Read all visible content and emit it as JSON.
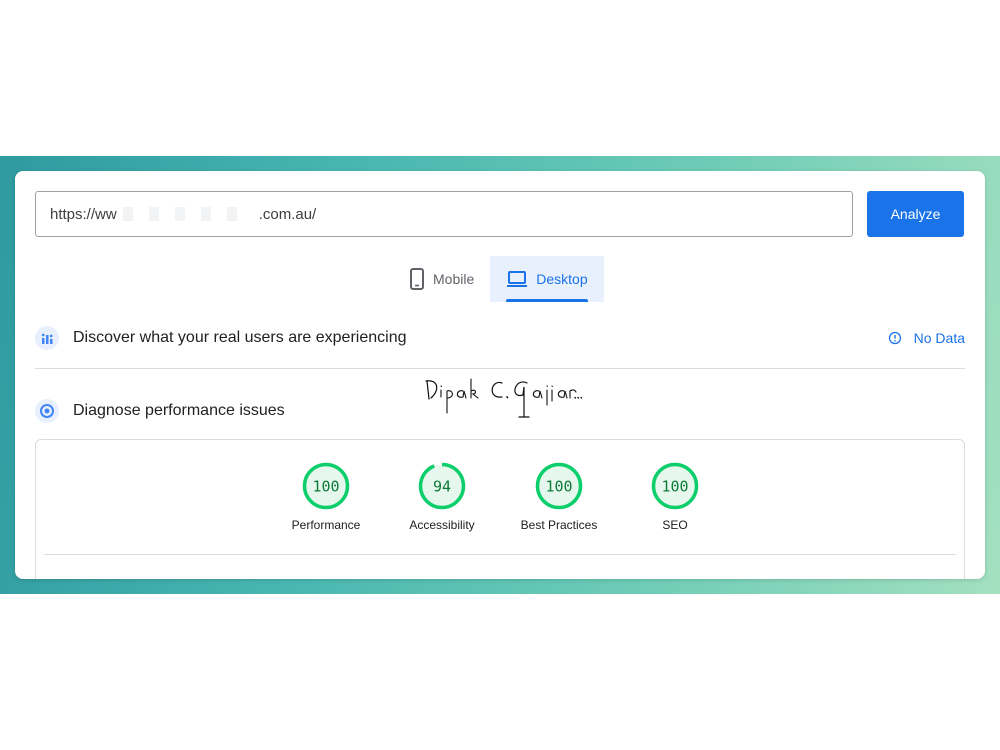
{
  "url_input": {
    "value_prefix": "https://ww",
    "value_suffix": ".com.au/"
  },
  "analyze_label": "Analyze",
  "tabs": [
    {
      "label": "Mobile",
      "icon": "phone-icon",
      "active": false
    },
    {
      "label": "Desktop",
      "icon": "laptop-icon",
      "active": true
    }
  ],
  "field_data": {
    "title": "Discover what your real users are experiencing",
    "status": "No Data",
    "icon": "users-chart-icon"
  },
  "lab_data": {
    "title": "Diagnose performance issues",
    "icon": "target-icon"
  },
  "scores": [
    {
      "label": "Performance",
      "value": 100
    },
    {
      "label": "Accessibility",
      "value": 94
    },
    {
      "label": "Best Practices",
      "value": 100
    },
    {
      "label": "SEO",
      "value": 100
    }
  ],
  "colors": {
    "accent": "#1a73e8",
    "pass": "#0cce6b",
    "pass_text": "#0c7a37",
    "pass_bg": "#e6f8ed"
  }
}
